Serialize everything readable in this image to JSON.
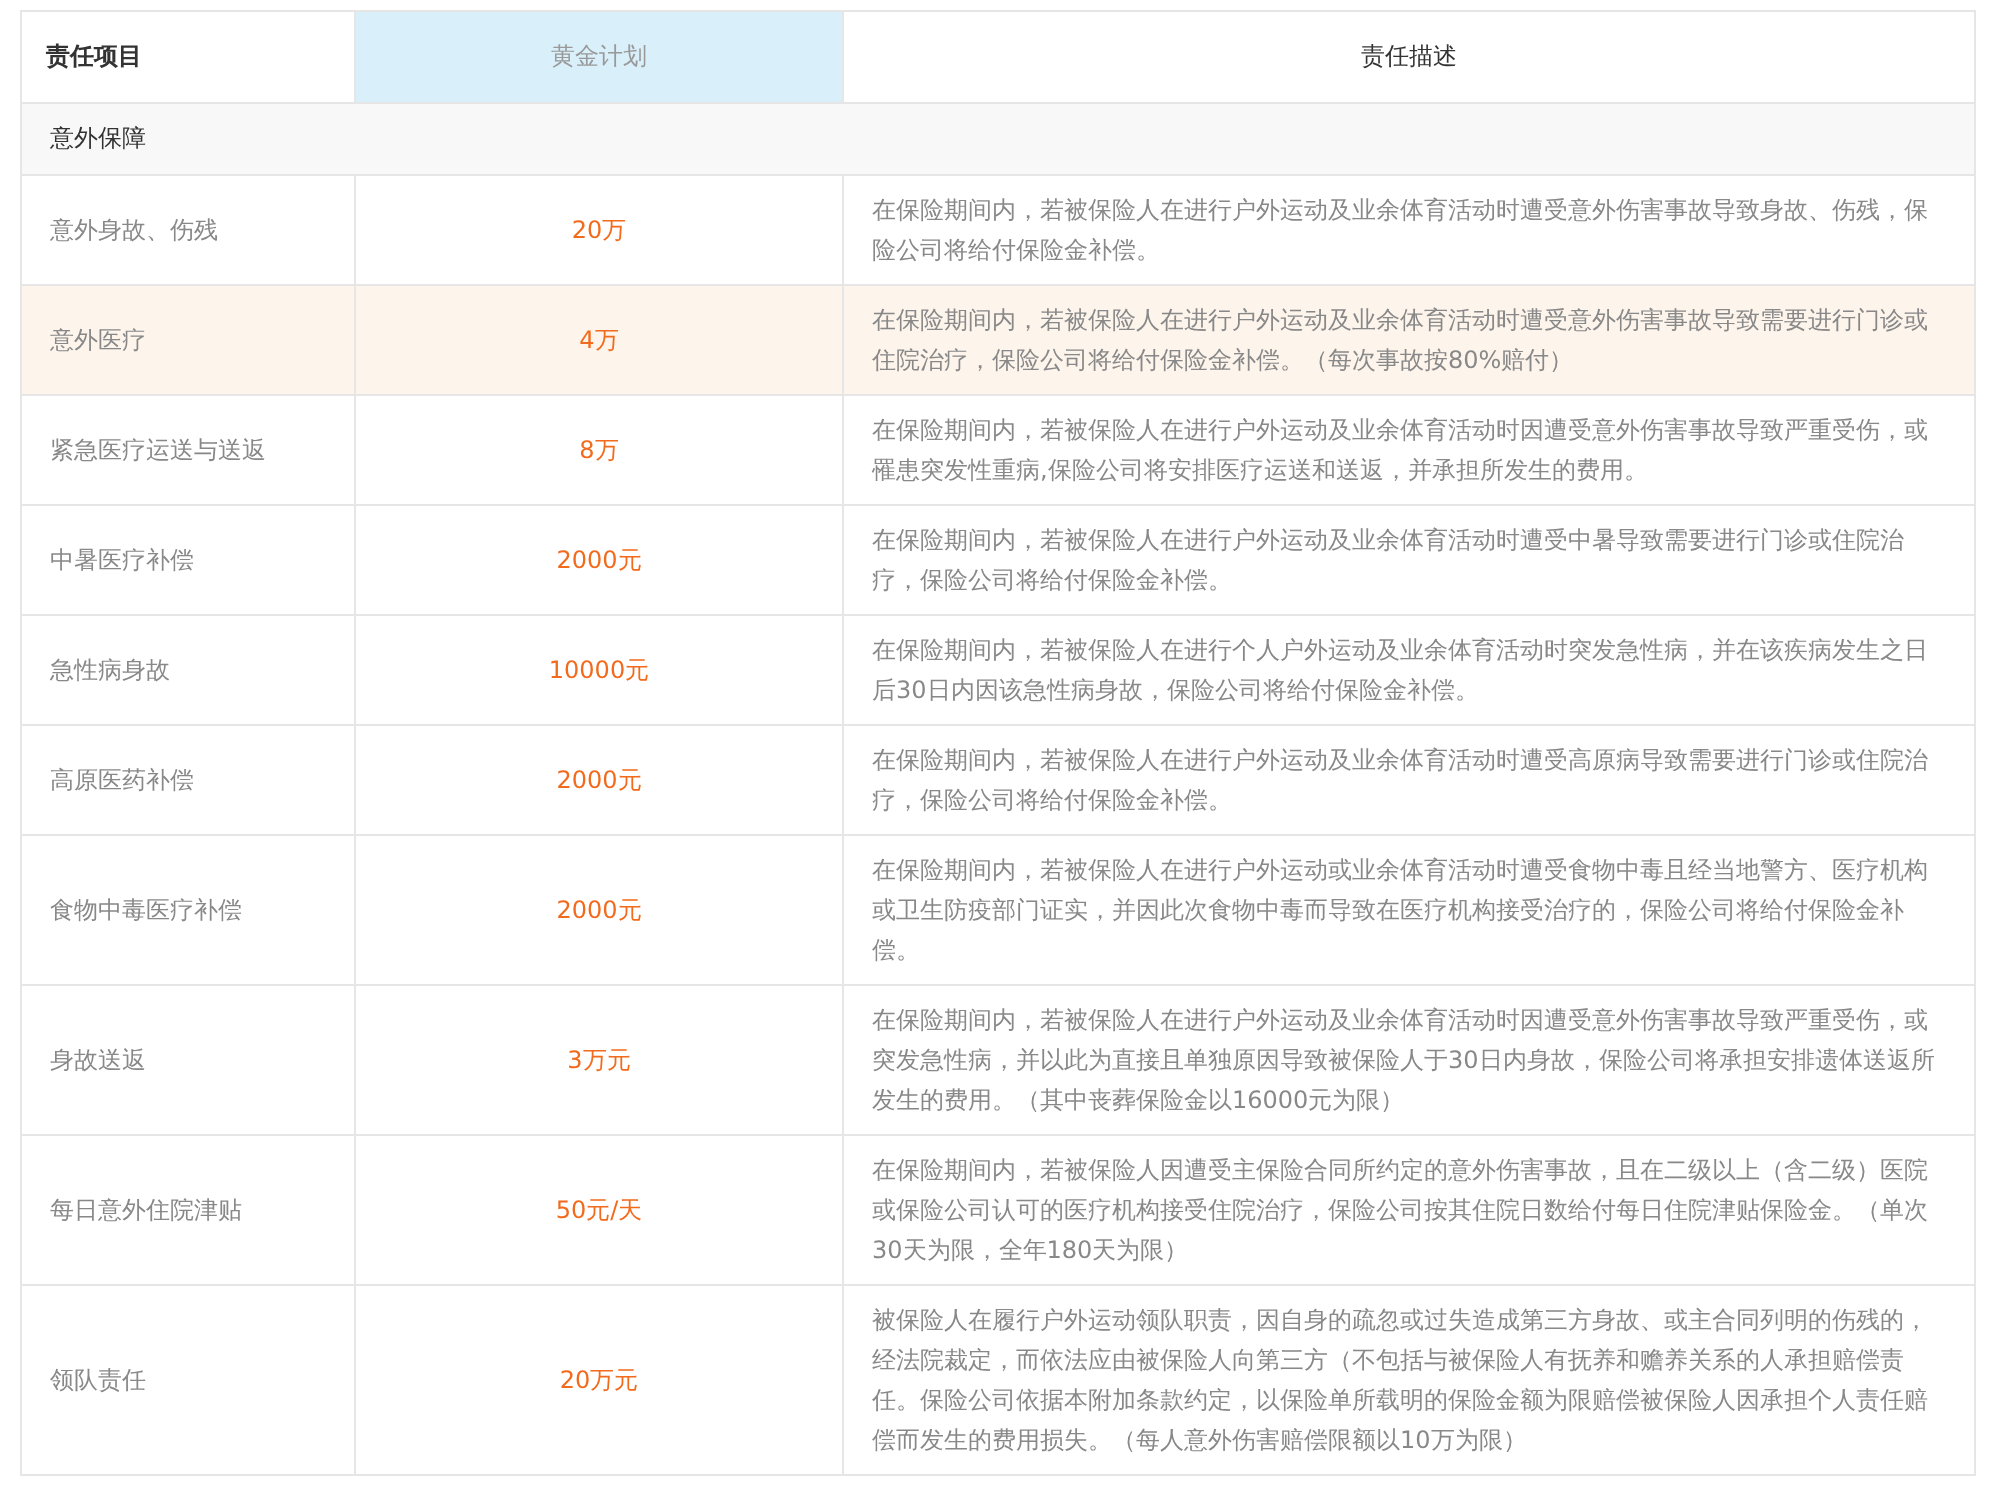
{
  "table": {
    "columns": [
      {
        "label": "责任项目",
        "selected": false
      },
      {
        "label": "黄金计划",
        "selected": true
      },
      {
        "label": "责任描述",
        "selected": false
      }
    ],
    "section": "意外保障",
    "rows": [
      {
        "item": "意外身故、伤残",
        "amount": "20万",
        "description": "在保险期间内，若被保险人在进行户外运动及业余体育活动时遭受意外伤害事故导致身故、伤残，保险公司将给付保险金补偿。",
        "highlighted": false
      },
      {
        "item": "意外医疗",
        "amount": "4万",
        "description": "在保险期间内，若被保险人在进行户外运动及业余体育活动时遭受意外伤害事故导致需要进行门诊或住院治疗，保险公司将给付保险金补偿。（每次事故按80%赔付）",
        "highlighted": true
      },
      {
        "item": "紧急医疗运送与送返",
        "amount": "8万",
        "description": "在保险期间内，若被保险人在进行户外运动及业余体育活动时因遭受意外伤害事故导致严重受伤，或罹患突发性重病,保险公司将安排医疗运送和送返，并承担所发生的费用。",
        "highlighted": false
      },
      {
        "item": "中暑医疗补偿",
        "amount": "2000元",
        "description": "在保险期间内，若被保险人在进行户外运动及业余体育活动时遭受中暑导致需要进行门诊或住院治疗，保险公司将给付保险金补偿。",
        "highlighted": false
      },
      {
        "item": "急性病身故",
        "amount": "10000元",
        "description": "在保险期间内，若被保险人在进行个人户外运动及业余体育活动时突发急性病，并在该疾病发生之日后30日内因该急性病身故，保险公司将给付保险金补偿。",
        "highlighted": false
      },
      {
        "item": "高原医药补偿",
        "amount": "2000元",
        "description": "在保险期间内，若被保险人在进行户外运动及业余体育活动时遭受高原病导致需要进行门诊或住院治疗，保险公司将给付保险金补偿。",
        "highlighted": false
      },
      {
        "item": "食物中毒医疗补偿",
        "amount": "2000元",
        "description": "在保险期间内，若被保险人在进行户外运动或业余体育活动时遭受食物中毒且经当地警方、医疗机构或卫生防疫部门证实，并因此次食物中毒而导致在医疗机构接受治疗的，保险公司将给付保险金补偿。",
        "highlighted": false
      },
      {
        "item": "身故送返",
        "amount": "3万元",
        "description": "在保险期间内，若被保险人在进行户外运动及业余体育活动时因遭受意外伤害事故导致严重受伤，或突发急性病，并以此为直接且单独原因导致被保险人于30日内身故，保险公司将承担安排遗体送返所发生的费用。（其中丧葬保险金以16000元为限）",
        "highlighted": false
      },
      {
        "item": "每日意外住院津贴",
        "amount": "50元/天",
        "description": "在保险期间内，若被保险人因遭受主保险合同所约定的意外伤害事故，且在二级以上（含二级）医院或保险公司认可的医疗机构接受住院治疗，保险公司按其住院日数给付每日住院津贴保险金。（单次30天为限，全年180天为限）",
        "highlighted": false
      },
      {
        "item": "领队责任",
        "amount": "20万元",
        "description": "被保险人在履行户外运动领队职责，因自身的疏忽或过失造成第三方身故、或主合同列明的伤残的，经法院裁定，而依法应由被保险人向第三方（不包括与被保险人有抚养和赡养关系的人承担赔偿责任。保险公司依据本附加条款约定，以保险单所载明的保险金额为限赔偿被保险人因承担个人责任赔偿而发生的费用损失。（每人意外伤害赔偿限额以10万为限）",
        "highlighted": false
      }
    ]
  }
}
